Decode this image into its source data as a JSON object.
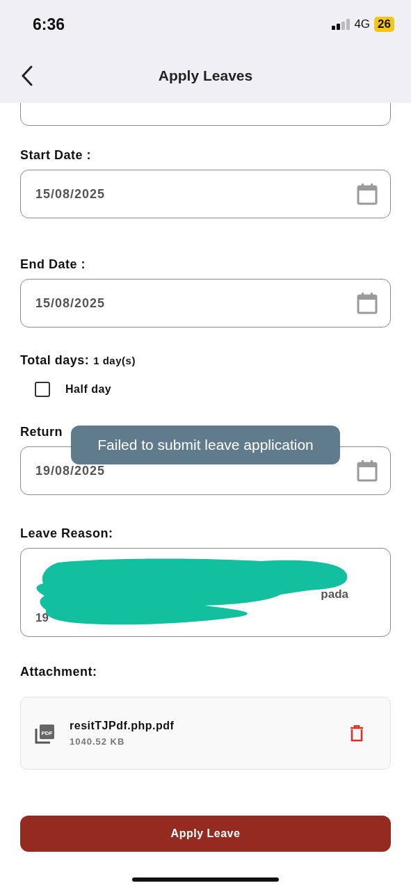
{
  "status_bar": {
    "time": "6:36",
    "network": "4G",
    "battery": "26"
  },
  "header": {
    "title": "Apply Leaves"
  },
  "start_date": {
    "label": "Start Date :",
    "value": "15/08/2025"
  },
  "end_date": {
    "label": "End Date :",
    "value": "15/08/2025"
  },
  "total_days": {
    "label": "Total days:",
    "value": "1 day(s)"
  },
  "half_day": {
    "label": "Half day",
    "checked": false
  },
  "return_date": {
    "label": "Return",
    "value": "19/08/2025"
  },
  "leave_reason": {
    "label": "Leave Reason:",
    "visible_fragments": [
      "pada",
      "19"
    ]
  },
  "attachment": {
    "label": "Attachment:",
    "icon_label": "PDF",
    "file_name": "resitTJPdf.php.pdf",
    "file_size": "1040.52 KB"
  },
  "toast": {
    "message": "Failed to submit leave application"
  },
  "submit_button": {
    "label": "Apply Leave"
  }
}
